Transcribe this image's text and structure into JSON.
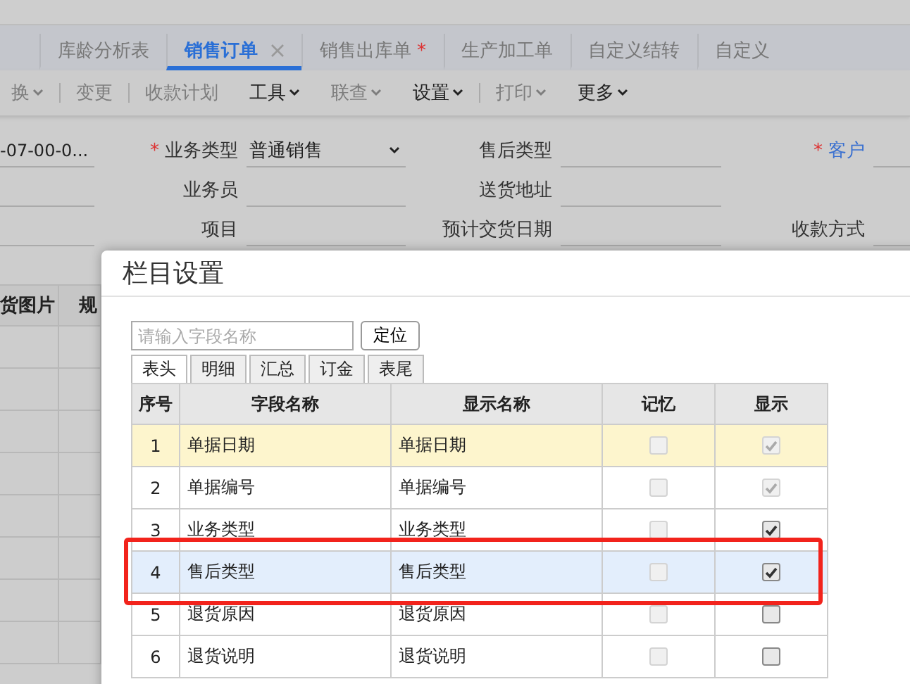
{
  "tabs": [
    {
      "label": "库龄分析表",
      "selected": false,
      "closable": false
    },
    {
      "label": "销售订单",
      "selected": true,
      "closable": true
    },
    {
      "label": "销售出库单",
      "selected": false,
      "closable": false,
      "modified_mark": "*"
    },
    {
      "label": "生产加工单",
      "selected": false,
      "closable": false
    },
    {
      "label": "自定义结转",
      "selected": false,
      "closable": false
    },
    {
      "label": "自定义",
      "selected": false,
      "closable": false
    }
  ],
  "toolbar": [
    {
      "label": "换",
      "dropdown": true,
      "disabled": true,
      "divider_after": true
    },
    {
      "label": "变更",
      "dropdown": false,
      "disabled": true,
      "divider_after": true
    },
    {
      "label": "收款计划",
      "dropdown": false,
      "disabled": true,
      "divider_after": false
    },
    {
      "label": "工具",
      "dropdown": true,
      "disabled": false,
      "divider_after": false
    },
    {
      "label": "联查",
      "dropdown": true,
      "disabled": true,
      "divider_after": false
    },
    {
      "label": "设置",
      "dropdown": true,
      "disabled": false,
      "divider_after": true
    },
    {
      "label": "打印",
      "dropdown": true,
      "disabled": true,
      "divider_after": false
    },
    {
      "label": "更多",
      "dropdown": true,
      "disabled": false,
      "divider_after": false
    }
  ],
  "form": {
    "rows": [
      {
        "lead_value": "-07-00-0...",
        "fields": [
          {
            "label": "业务类型",
            "required_mark": "*",
            "link": false,
            "value": "普通销售",
            "kind": "select"
          },
          {
            "label": "售后类型",
            "link": false,
            "kind": "text"
          },
          {
            "label": "客户",
            "required_mark": "*",
            "link": true,
            "kind": "text"
          }
        ]
      },
      {
        "fields": [
          {
            "label": "业务员",
            "link": false,
            "kind": "text"
          },
          {
            "label": "送货地址",
            "link": false,
            "kind": "text"
          }
        ]
      },
      {
        "fields": [
          {
            "label": "项目",
            "link": false,
            "kind": "text"
          },
          {
            "label": "预计交货日期",
            "link": false,
            "kind": "text"
          },
          {
            "label": "收款方式",
            "link": false,
            "kind": "text"
          }
        ]
      }
    ]
  },
  "background_grid": {
    "columns": [
      "货图片",
      "规"
    ]
  },
  "dialog": {
    "title": "栏目设置",
    "search": {
      "placeholder": "请输入字段名称",
      "button": "定位"
    },
    "tabs": [
      {
        "label": "表头",
        "selected": true
      },
      {
        "label": "明细",
        "selected": false
      },
      {
        "label": "汇总",
        "selected": false
      },
      {
        "label": "订金",
        "selected": false
      },
      {
        "label": "表尾",
        "selected": false
      }
    ],
    "columns": [
      "序号",
      "字段名称",
      "显示名称",
      "记忆",
      "显示"
    ],
    "rows": [
      {
        "no": "1",
        "field": "单据日期",
        "display": "单据日期",
        "selected": true,
        "highlighted": false,
        "annotated": false,
        "remember": false,
        "remember_disabled": true,
        "show": true,
        "show_disabled": true
      },
      {
        "no": "2",
        "field": "单据编号",
        "display": "单据编号",
        "selected": false,
        "highlighted": false,
        "annotated": false,
        "remember": false,
        "remember_disabled": true,
        "show": true,
        "show_disabled": true
      },
      {
        "no": "3",
        "field": "业务类型",
        "display": "业务类型",
        "selected": false,
        "highlighted": false,
        "annotated": false,
        "remember": false,
        "remember_disabled": true,
        "show": true,
        "show_disabled": false
      },
      {
        "no": "4",
        "field": "售后类型",
        "display": "售后类型",
        "selected": false,
        "highlighted": true,
        "annotated": true,
        "remember": false,
        "remember_disabled": true,
        "show": true,
        "show_disabled": false
      },
      {
        "no": "5",
        "field": "退货原因",
        "display": "退货原因",
        "selected": false,
        "highlighted": false,
        "annotated": false,
        "remember": false,
        "remember_disabled": true,
        "show": false,
        "show_disabled": false
      },
      {
        "no": "6",
        "field": "退货说明",
        "display": "退货说明",
        "selected": false,
        "highlighted": false,
        "annotated": false,
        "remember": false,
        "remember_disabled": true,
        "show": false,
        "show_disabled": false
      }
    ]
  }
}
